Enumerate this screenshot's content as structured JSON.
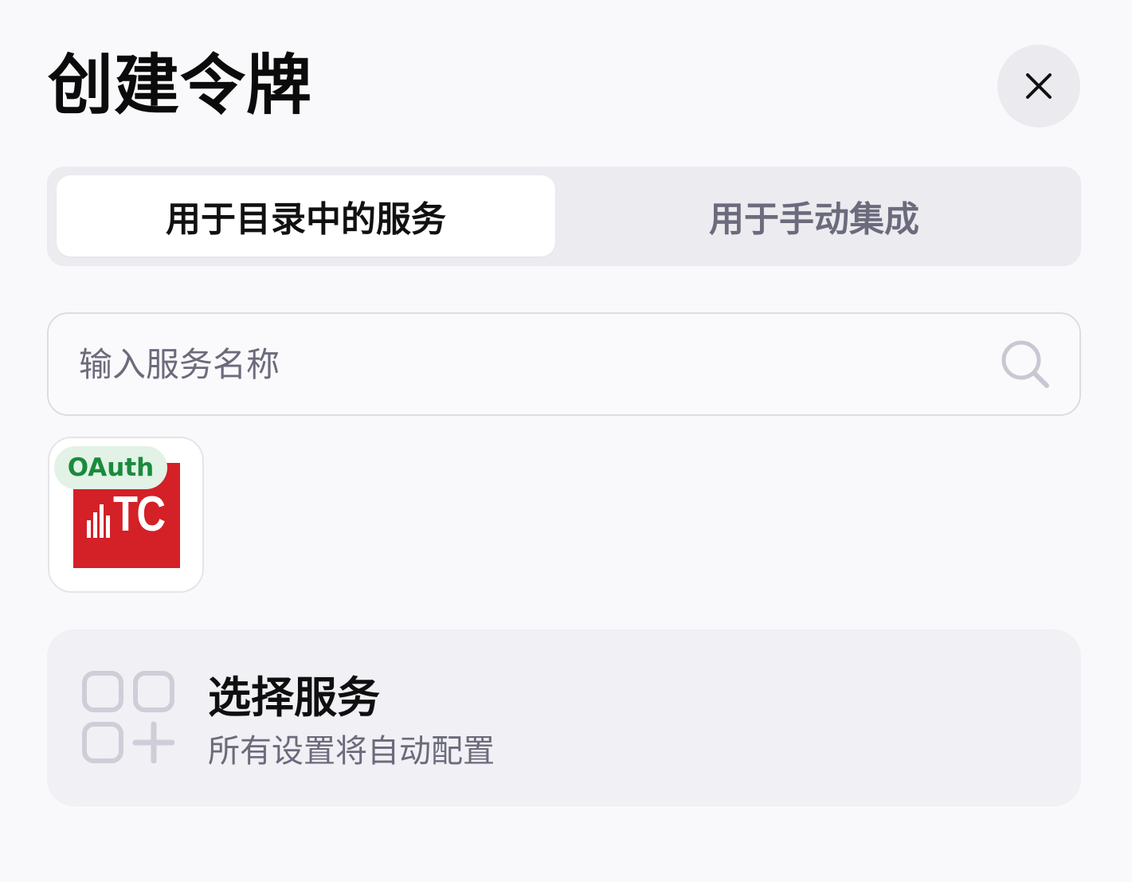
{
  "header": {
    "title": "创建令牌",
    "close_icon": "close-icon"
  },
  "tabs": [
    {
      "label": "用于目录中的服务",
      "active": true
    },
    {
      "label": "用于手动集成",
      "active": false
    }
  ],
  "search": {
    "placeholder": "输入服务名称",
    "value": "",
    "icon": "search-icon"
  },
  "services": [
    {
      "logo_text": "TC",
      "badge": "OAuth",
      "logo_color": "#d42027",
      "badge_color": "#1b8a3d"
    }
  ],
  "choose_service": {
    "title": "选择服务",
    "subtitle": "所有设置将自动配置",
    "icon": "apps-add-icon"
  }
}
